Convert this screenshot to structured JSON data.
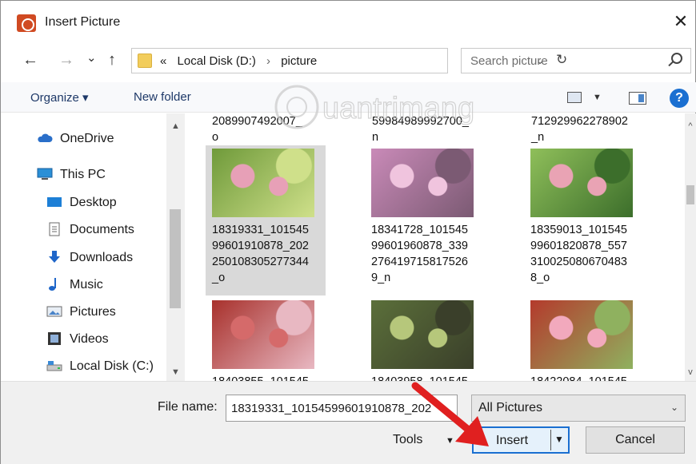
{
  "window": {
    "title": "Insert Picture",
    "close_glyph": "✕"
  },
  "nav": {
    "back": "←",
    "forward": "→",
    "recent": "⌄",
    "up": "↑",
    "breadcrumb": {
      "prefix": "«",
      "root": "Local Disk (D:)",
      "separator": "›",
      "current": "picture"
    },
    "dropdown": "⌄",
    "refresh": "↻",
    "search_placeholder": "Search picture"
  },
  "toolbar": {
    "organize": "Organize ▾",
    "new_folder": "New folder",
    "help": "?"
  },
  "sidebar": {
    "items": [
      {
        "label": "OneDrive",
        "icon": "cloud-icon",
        "color": "#2a6fc9"
      },
      {
        "label": "This PC",
        "icon": "computer-icon",
        "color": "#2a8fd6"
      },
      {
        "label": "Desktop",
        "icon": "desktop-icon",
        "color": "#1d7fd6"
      },
      {
        "label": "Documents",
        "icon": "document-icon",
        "color": "#6a6a6a"
      },
      {
        "label": "Downloads",
        "icon": "download-icon",
        "color": "#1f66c9"
      },
      {
        "label": "Music",
        "icon": "music-icon",
        "color": "#1f66c9"
      },
      {
        "label": "Pictures",
        "icon": "pictures-icon",
        "color": "#6a6a6a"
      },
      {
        "label": "Videos",
        "icon": "videos-icon",
        "color": "#333333"
      },
      {
        "label": "Local Disk (C:)",
        "icon": "drive-icon",
        "color": "#3a8ad6"
      }
    ]
  },
  "files": {
    "top_partial": [
      {
        "line1": "2089907492007_",
        "line2": "o"
      },
      {
        "line1": "59984989992700_",
        "line2": "n"
      },
      {
        "line1": "712929962278902",
        "line2": "_n"
      }
    ],
    "items": [
      {
        "name_lines": [
          "18319331_101545",
          "99601910878_202",
          "250108305277344",
          "_o"
        ],
        "selected": true,
        "palette": [
          "#6f9a3a",
          "#e7a0b7",
          "#cfe08a"
        ]
      },
      {
        "name_lines": [
          "18341728_101545",
          "99601960878_339",
          "276419715817526",
          "9_n"
        ],
        "selected": false,
        "palette": [
          "#c98ab8",
          "#f0c4de",
          "#7b5a73"
        ]
      },
      {
        "name_lines": [
          "18359013_101545",
          "99601820878_557",
          "310025080670483",
          "8_o"
        ],
        "selected": false,
        "palette": [
          "#8fbf5a",
          "#e9a3b4",
          "#3c6e2b"
        ]
      },
      {
        "name_lines": [
          "18403855_101545"
        ],
        "selected": false,
        "palette": [
          "#a8312c",
          "#d56a6a",
          "#e8b8c2"
        ]
      },
      {
        "name_lines": [
          "18403958_101545"
        ],
        "selected": false,
        "palette": [
          "#5b6f3a",
          "#b6c77b",
          "#3a3f2a"
        ]
      },
      {
        "name_lines": [
          "18422084_101545"
        ],
        "selected": false,
        "palette": [
          "#b43a2c",
          "#f2a9bd",
          "#8fb15f"
        ]
      }
    ]
  },
  "footer": {
    "file_name_label": "File name:",
    "file_name_value": "18319331_10154599601910878_202",
    "filter_value": "All Pictures",
    "tools_label": "Tools",
    "insert_label": "Insert",
    "cancel_label": "Cancel"
  },
  "watermark": {
    "text": "uantrimang"
  },
  "colors": {
    "accent": "#1a6fd1",
    "arrow": "#e02020"
  }
}
